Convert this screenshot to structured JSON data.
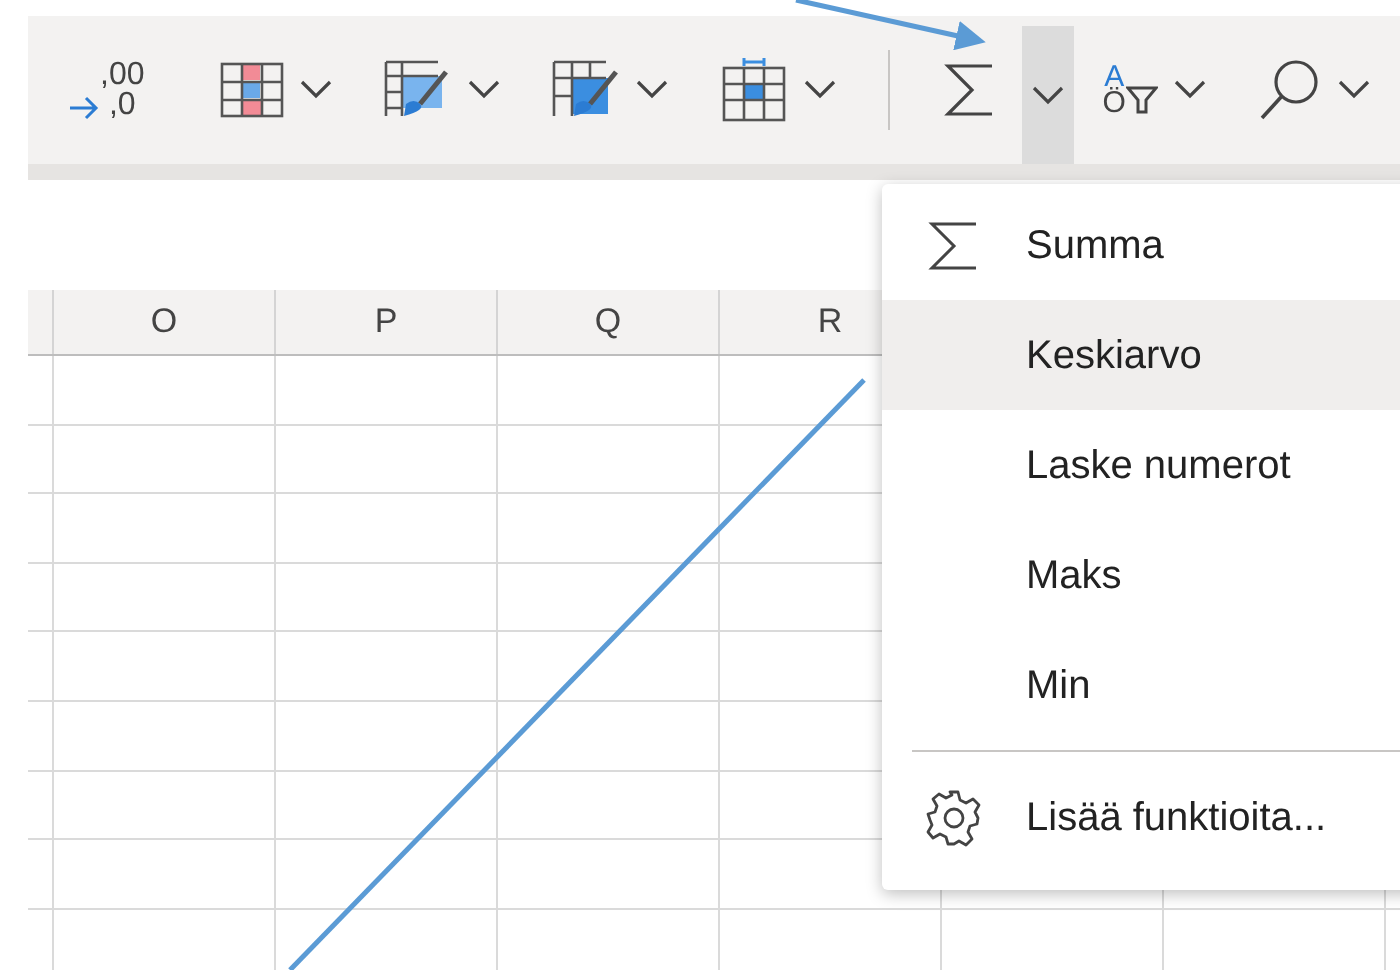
{
  "toolbar": {
    "decimal_button": {
      "upper": ",00",
      "lower": ",0"
    },
    "buttons": [
      {
        "kind": "highlight-cells",
        "has_menu": true,
        "selected": false
      },
      {
        "kind": "table-format",
        "has_menu": true,
        "selected": false
      },
      {
        "kind": "cell-styles",
        "has_menu": true,
        "selected": false
      },
      {
        "kind": "format-cells",
        "has_menu": true,
        "selected": false
      },
      {
        "kind": "separator"
      },
      {
        "kind": "sum",
        "has_menu": true,
        "selected": true
      },
      {
        "kind": "sort-filter",
        "has_menu": true,
        "selected": false,
        "top": "A",
        "bottom": "Ö"
      },
      {
        "kind": "find",
        "has_menu": true,
        "selected": false
      }
    ]
  },
  "sheet": {
    "columns": [
      "O",
      "P",
      "Q",
      "R"
    ]
  },
  "menu": {
    "items": [
      {
        "kind": "sum",
        "label": "Summa",
        "selected": false
      },
      {
        "kind": "plain",
        "label": "Keskiarvo",
        "selected": true
      },
      {
        "kind": "plain",
        "label": "Laske numerot",
        "selected": false
      },
      {
        "kind": "plain",
        "label": "Maks",
        "selected": false
      },
      {
        "kind": "plain",
        "label": "Min",
        "selected": false
      },
      {
        "kind": "separator"
      },
      {
        "kind": "gear",
        "label": "Lisää funktioita...",
        "selected": false
      }
    ]
  }
}
